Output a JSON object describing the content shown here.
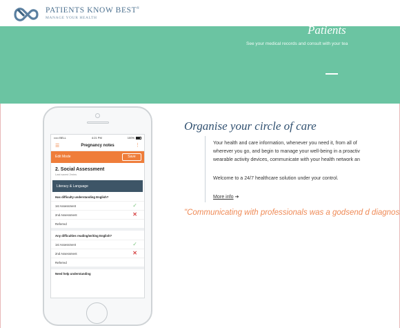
{
  "header": {
    "brand_name": "PATIENTS KNOW BEST",
    "brand_mark": "®",
    "brand_tagline": "MANAGE YOUR HEALTH",
    "logo_icon": "linked-rings-logo-icon"
  },
  "hero": {
    "title": "Patients",
    "subtitle": "See your medical records and consult with your tea"
  },
  "phone": {
    "status_carrier": "••••• BELL",
    "status_time": "4:21 PM",
    "status_battery": "100%",
    "nav_title": "Pregnancy notes",
    "edit_mode": "Edit Mode",
    "save_label": "Save",
    "section_title": "2. Social Assessment",
    "section_subtitle": "Last saved 2mins",
    "group_title": "Literacy & Language",
    "questions": [
      {
        "title": "Has difficulty understanding English?",
        "rows": [
          {
            "label": "1st Assessment",
            "mark": "✓"
          },
          {
            "label": "2nd Assessment",
            "mark": "✕"
          },
          {
            "label": "Referred",
            "mark": ""
          }
        ]
      },
      {
        "title": "Any difficulties reading/writing English?",
        "rows": [
          {
            "label": "1st Assessment",
            "mark": "✓"
          },
          {
            "label": "2nd Assessment",
            "mark": "✕"
          },
          {
            "label": "Referred",
            "mark": ""
          }
        ]
      }
    ],
    "cut_off_text": "Need help understanding"
  },
  "content": {
    "title": "Organise your circle of care",
    "body_lines": [
      "Your health and care information, whenever you need it, from all of",
      "wherever you go, and begin to manage your well-being in a proactiv",
      "wearable activity devices, communicate with your health network an"
    ],
    "welcome": "Welcome to a 24/7 healthcare solution under your control.",
    "more_info": "More info",
    "more_arrow": "➔",
    "quote": "\"Communicating with professionals was a godsend d diagnosis\""
  },
  "colors": {
    "hero_green": "#6bc4a2",
    "accent_orange": "#ef7d3a",
    "navy_title": "#2f4f6f",
    "group_bar": "#3d5567"
  }
}
